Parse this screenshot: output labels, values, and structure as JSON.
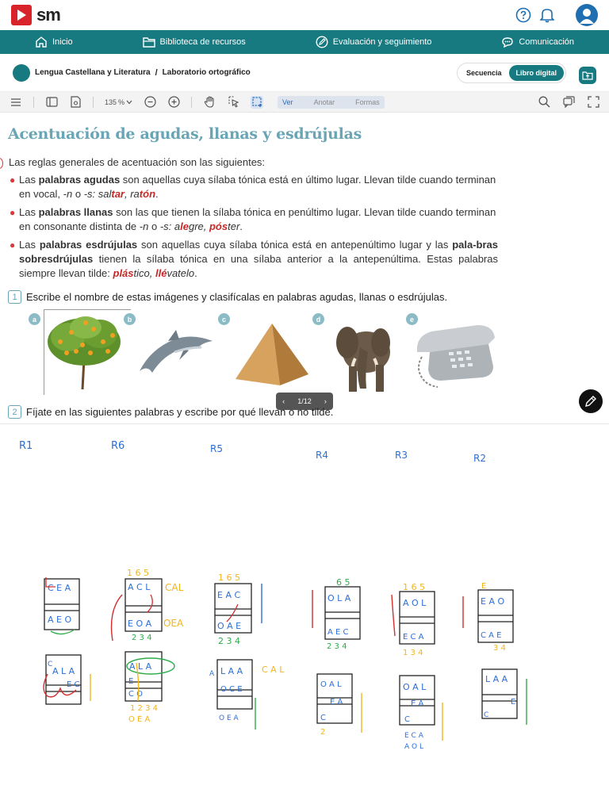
{
  "header": {
    "brand": "sm",
    "icons": [
      "help-icon",
      "bell-icon",
      "user-avatar"
    ]
  },
  "nav": {
    "items": [
      {
        "label": "Inicio",
        "icon": "home-icon"
      },
      {
        "label": "Biblioteca de recursos",
        "icon": "folder-icon"
      },
      {
        "label": "Evaluación y seguimiento",
        "icon": "edit-circle-icon"
      },
      {
        "label": "Comunicación",
        "icon": "chat-icon"
      }
    ]
  },
  "breadcrumb": {
    "subject": "Lengua Castellana y Literatura",
    "separator": "/",
    "unit": "Laboratorio ortográfico"
  },
  "view_switch": {
    "options": [
      "Secuencia",
      "Libro digital"
    ],
    "active": "Libro digital"
  },
  "toolbar": {
    "zoom_value": "135",
    "zoom_unit": "%",
    "modes": [
      "Ver",
      "Anotar",
      "Formas"
    ],
    "active_mode": "Ver"
  },
  "doc": {
    "title": "Acentuación de agudas, llanas y esdrújulas",
    "intro": "Las reglas generales de acentuación son las siguientes:",
    "b1": {
      "a": "Las ",
      "term": "palabras agudas",
      "b": " son aquellas cuya sílaba tónica está en último lugar. Llevan tilde cuando terminan en vocal, ",
      "n": "-n",
      "o": " o ",
      "s": "-s",
      "c": ": sal",
      "ex1": "tar",
      "d": ", ra",
      "ex2": "tón",
      "e": "."
    },
    "b2": {
      "a": "Las ",
      "term": "palabras llanas",
      "b": " son las que tienen la sílaba tónica en penúltimo lugar. Llevan tilde cuando terminan en consonante distinta de ",
      "n": "-n",
      "o": " o ",
      "s": "-s",
      "c": ": a",
      "ex1": "le",
      "d": "gre, ",
      "ex2": "pós",
      "e": "ter",
      "f": "."
    },
    "b3": {
      "a": "Las ",
      "term": "palabras esdrújulas",
      "b": " son aquellas cuya sílaba tónica está en antepenúltimo lugar y las ",
      "term2": "pala-bras sobresdrújulas",
      "c": " tienen la sílaba tónica en una sílaba anterior a la antepenúltima. Estas palabras siempre llevan tilde: ",
      "ex1": "plás",
      "d": "tico, ",
      "ex2": "llé",
      "e": "vatelo",
      "f": "."
    },
    "ex1": {
      "num": "1",
      "text": "Escribe el nombre de estas imágenes y clasifícalas en palabras agudas, llanas o esdrújulas."
    },
    "ex2": {
      "num": "2",
      "text": "Fíjate en las siguientes palabras y escribe por qué llevan o no tilde."
    },
    "image_letters": [
      "a",
      "b",
      "c",
      "d",
      "e"
    ],
    "pager": {
      "current": "1",
      "sep": "/",
      "total": "12"
    }
  },
  "handwriting": {
    "labels": [
      "R1",
      "R6",
      "R5",
      "R4",
      "R3",
      "R2"
    ],
    "row1": {
      "r1": {
        "top": "C E A",
        "bot": "A E O"
      },
      "r6": {
        "nums": "1 6 5",
        "top": "A C L",
        "side": "CAL",
        "bot": "E O A",
        "side2": "OEA",
        "nums2": "2 3 4"
      },
      "r5": {
        "nums": "1 6 5",
        "top": "E A C",
        "bot": "O A E",
        "nums2": "2 3 4"
      },
      "r4": {
        "nums": "6 5",
        "top": "O L A",
        "bot": "A E C",
        "nums2": "2 3 4"
      },
      "r3": {
        "nums": "1 6 5",
        "top": "A O L",
        "bot": "E C A",
        "nums2": "1 3 4"
      },
      "r2": {
        "top": "E A O",
        "bot": "C A E",
        "nums2": "3 4",
        "mark": "E"
      }
    },
    "row2": {
      "c1": {
        "top": "C",
        "mid": "A L A",
        "low": "E C"
      },
      "c2": {
        "top": "A L A",
        "mid": "E",
        "low": "C O",
        "nums": "1 2 3 4",
        "bot": "O E A"
      },
      "c3": {
        "side": "A",
        "top": "L A A",
        "side2": "C A L",
        "mid": "O C E",
        "bot": "O E A"
      },
      "c4": {
        "top": "O A L",
        "mid": "E A",
        "low": "C",
        "num": "2"
      },
      "c5": {
        "top": "O A L",
        "mid": "E A",
        "low": "C",
        "bot1": "E C A",
        "bot2": "A O L"
      },
      "c6": {
        "top": "L A A",
        "mid": "E",
        "low": "C"
      }
    }
  }
}
